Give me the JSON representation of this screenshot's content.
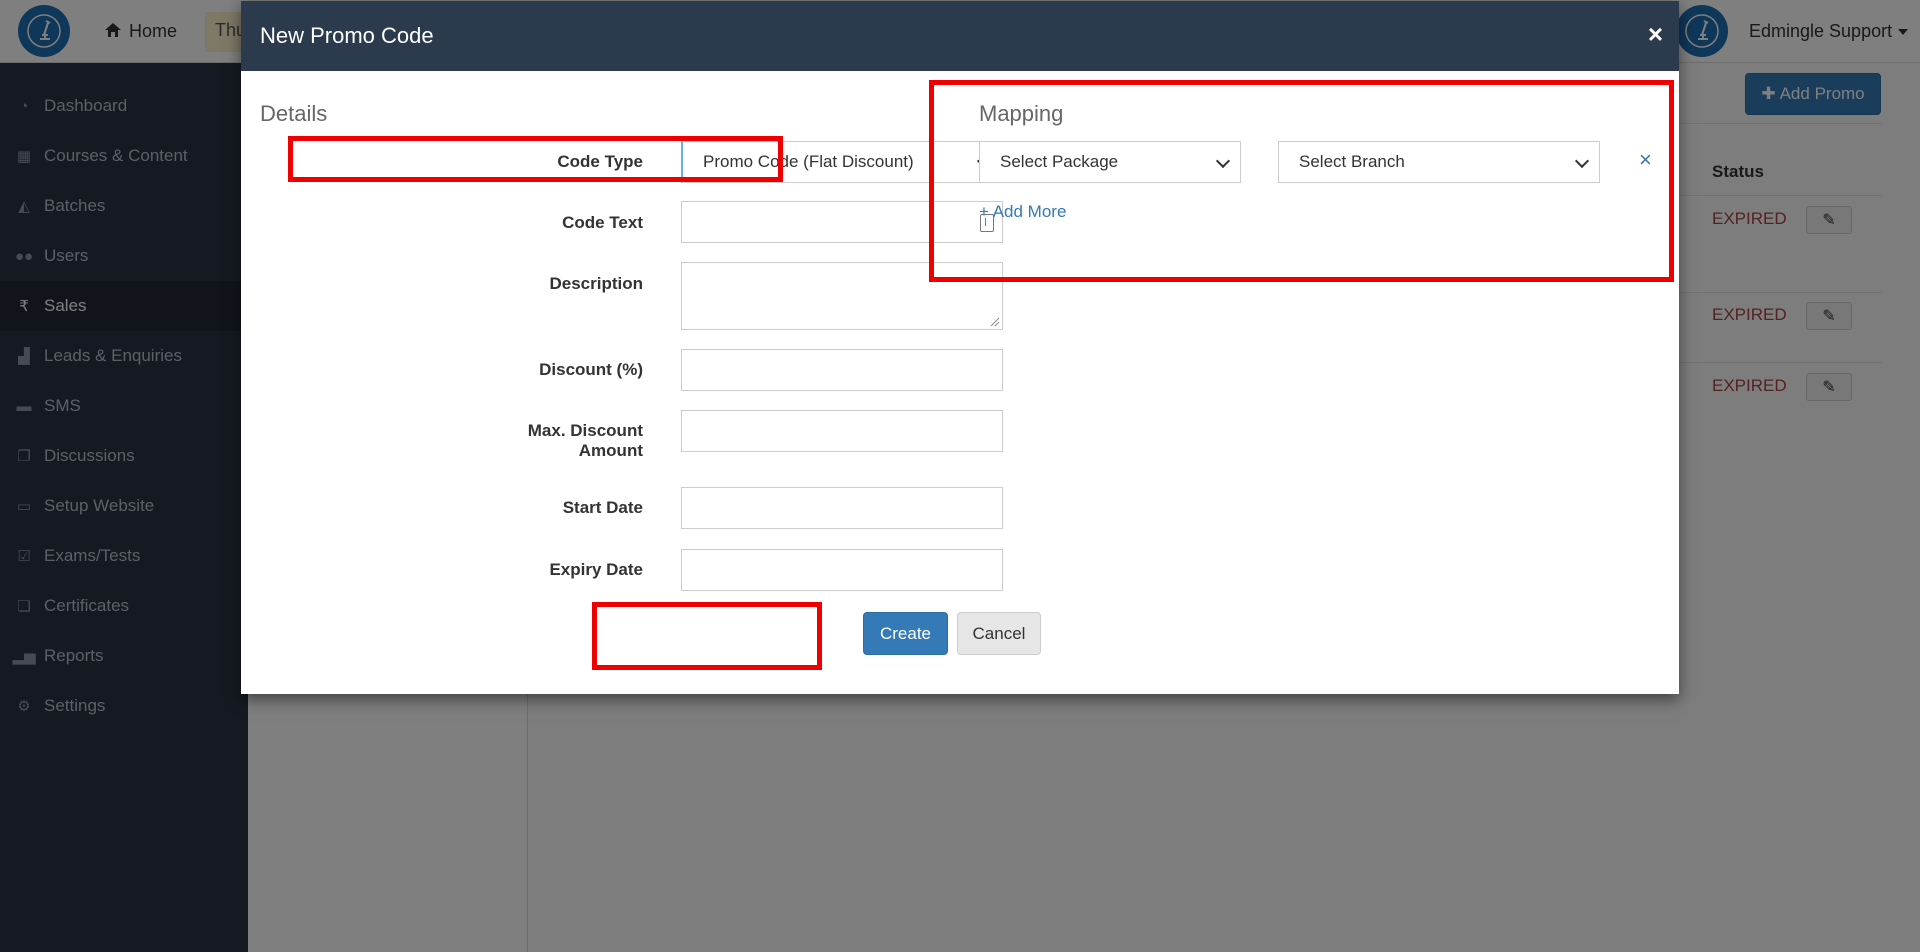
{
  "topbar": {
    "home_label": "Home",
    "partial_tab_label": "Thu",
    "user_name": "Edmingle Support"
  },
  "sidebar": {
    "items": [
      {
        "label": "Dashboard",
        "icon": "dashboard-icon"
      },
      {
        "label": "Courses & Content",
        "icon": "courses-icon"
      },
      {
        "label": "Batches",
        "icon": "graduation-cap-icon"
      },
      {
        "label": "Users",
        "icon": "users-icon"
      },
      {
        "label": "Sales",
        "icon": "rupee-icon"
      },
      {
        "label": "Leads & Enquiries",
        "icon": "leads-icon"
      },
      {
        "label": "SMS",
        "icon": "sms-icon"
      },
      {
        "label": "Discussions",
        "icon": "discussions-icon"
      },
      {
        "label": "Setup Website",
        "icon": "laptop-icon"
      },
      {
        "label": "Exams/Tests",
        "icon": "checkbox-icon"
      },
      {
        "label": "Certificates",
        "icon": "certificates-icon"
      },
      {
        "label": "Reports",
        "icon": "bar-chart-icon"
      },
      {
        "label": "Settings",
        "icon": "gear-icon"
      }
    ]
  },
  "background_page": {
    "add_promo_label": "Add Promo",
    "status_header": "Status",
    "rows": [
      {
        "status": "EXPIRED"
      },
      {
        "status": "EXPIRED"
      },
      {
        "status": "EXPIRED"
      }
    ]
  },
  "modal": {
    "title": "New Promo Code",
    "close_glyph": "×",
    "details": {
      "section_title": "Details",
      "code_type_label": "Code Type",
      "code_type_value": "Promo Code (Flat Discount)",
      "code_text_label": "Code Text",
      "description_label": "Description",
      "discount_label": "Discount (%)",
      "max_discount_label_line1": "Max. Discount",
      "max_discount_label_line2": "Amount",
      "start_date_label": "Start Date",
      "expiry_date_label": "Expiry Date",
      "code_text_value": "",
      "description_value": "",
      "discount_value": "",
      "max_discount_value": "",
      "start_date_value": "",
      "expiry_date_value": ""
    },
    "mapping": {
      "section_title": "Mapping",
      "package_placeholder": "Select Package",
      "branch_placeholder": "Select Branch",
      "remove_glyph": "×",
      "add_more_label": "+ Add More"
    },
    "buttons": {
      "create_label": "Create",
      "cancel_label": "Cancel"
    }
  },
  "colors": {
    "modal_header": "#2b3a4d",
    "primary": "#337ab7",
    "highlight": "#ee0000",
    "sidebar_bg": "#2b3444",
    "expired": "#a94442"
  }
}
